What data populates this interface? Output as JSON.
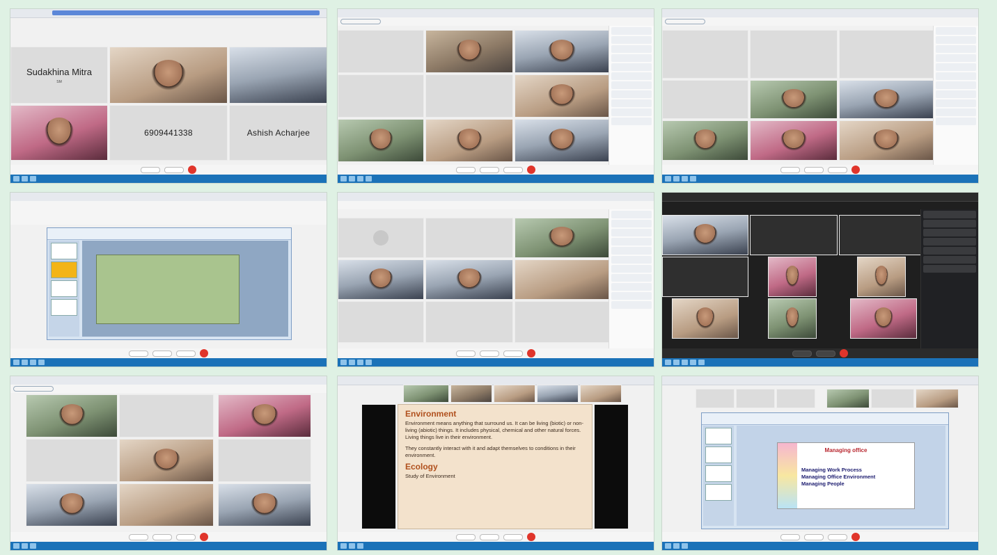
{
  "shot1": {
    "name_top_left": "Sudakhina Mitra",
    "name_top_left_sub": "SM",
    "phone_tile": "6909441338",
    "name_bottom_right": "Ashish Acharjee"
  },
  "shot8": {
    "slide_heading_1": "Environment",
    "bullet_1": "Environment means anything that surround us. It can be living (biotic) or non-living (abiotic) things. It includes physical, chemical and other natural forces. Living things live in their environment.",
    "bullet_2": "They constantly interact with it and adapt themselves to conditions in their environment.",
    "slide_heading_2": "Ecology",
    "bullet_3": "Study of Environment"
  },
  "shot9": {
    "slide_title": "Managing office",
    "item_1": "Managing Work Process",
    "item_2": "Managing Office Environment",
    "item_3": "Managing People"
  },
  "colors": {
    "end_call": "#e0352b",
    "taskbar": "#1b72b8",
    "page_bg": "#dff1e4",
    "slide_heading": "#b0501d"
  },
  "icons": [
    "end-call-icon",
    "mic-icon",
    "camera-icon",
    "participants-icon"
  ]
}
